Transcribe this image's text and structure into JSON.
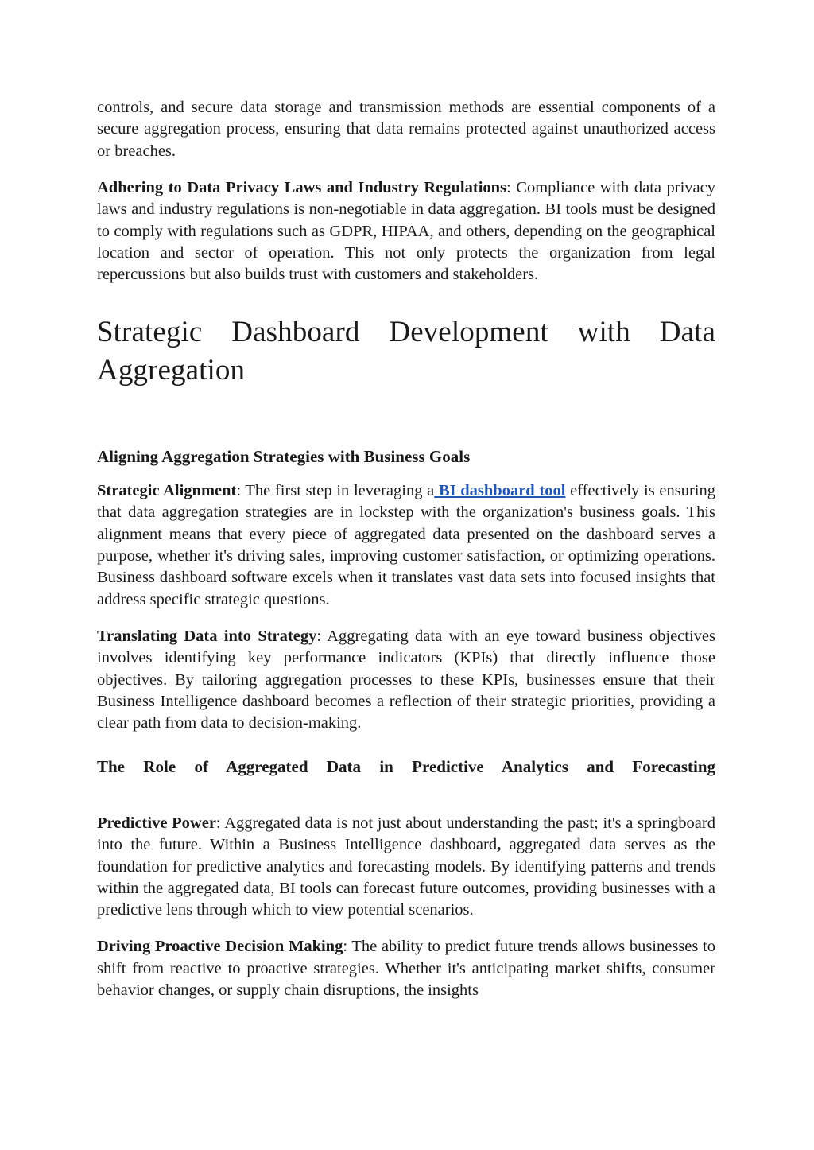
{
  "document": {
    "paragraph_continued": "controls, and secure data storage and transmission methods are essential components of a secure aggregation process, ensuring that data remains protected against unauthorized access or breaches.",
    "privacy_paragraph": {
      "lead_in": "Adhering to Data Privacy Laws and Industry Regulations",
      "separator": ": ",
      "body": "Compliance with data privacy laws and industry regulations is non-negotiable in data aggregation. BI tools must be designed to comply with regulations such as GDPR, HIPAA, and others, depending on the geographical location and sector of operation. This not only protects the organization from legal repercussions but also builds trust with customers and stakeholders."
    },
    "title": "Strategic Dashboard Development with Data Aggregation",
    "section_one": {
      "heading": "Aligning Aggregation Strategies with Business Goals",
      "strategic_alignment": {
        "lead_in": "Strategic Alignment",
        "separator": ": ",
        "body_before_link": "The first step in leveraging a",
        "link_text": " BI dashboard tool",
        "body_after_link": " effectively is ensuring that data aggregation strategies are in lockstep with the organization's business goals. This alignment means that every piece of aggregated data presented on the dashboard serves a purpose, whether it's driving sales, improving customer satisfaction, or optimizing operations. Business dashboard software excels when it translates vast data sets into focused insights that address specific strategic questions."
      },
      "translating_data": {
        "lead_in": "Translating Data into Strategy",
        "separator": ": ",
        "body": "Aggregating data with an eye toward business objectives involves identifying key performance indicators (KPIs) that directly influence those objectives. By tailoring aggregation processes to these KPIs, businesses ensure that their Business Intelligence dashboard becomes a reflection of their strategic priorities, providing a clear path from data to decision-making."
      }
    },
    "section_two": {
      "heading": "The Role of Aggregated Data in Predictive Analytics and Forecasting",
      "predictive_power": {
        "lead_in": "Predictive Power",
        "separator": ": ",
        "body_before_bold_comma": "Aggregated data is not just about understanding the past; it's a springboard into the future. Within a Business Intelligence dashboard",
        "bold_comma": ",",
        "body_after_bold_comma": " aggregated data serves as the foundation for predictive analytics and forecasting models. By identifying patterns and trends within the aggregated data, BI tools can forecast future outcomes, providing businesses with a predictive lens through which to view potential scenarios."
      },
      "driving_proactive": {
        "lead_in": "Driving Proactive Decision Making",
        "separator": ": ",
        "body": "The ability to predict future trends allows businesses to shift from reactive to proactive strategies. Whether it's anticipating market shifts, consumer behavior changes, or supply chain disruptions, the insights"
      }
    }
  },
  "theme": {
    "text_color": "#1a1a1a",
    "link_color": "#2256b3",
    "page_background": "#ffffff"
  }
}
